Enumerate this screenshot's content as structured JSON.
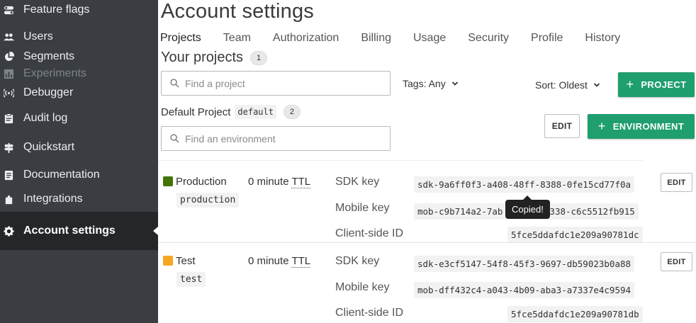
{
  "sidebar": {
    "items": [
      {
        "label": "Feature flags",
        "icon": "toggle-icon"
      },
      {
        "label": "Users",
        "icon": "users-icon"
      },
      {
        "label": "Segments",
        "icon": "pie-chart-icon"
      },
      {
        "label": "Experiments",
        "icon": "bar-chart-icon"
      },
      {
        "label": "Debugger",
        "icon": "broadcast-icon"
      },
      {
        "label": "Audit log",
        "icon": "clipboard-icon"
      },
      {
        "label": "Quickstart",
        "icon": "signpost-icon"
      },
      {
        "label": "Documentation",
        "icon": "book-icon"
      },
      {
        "label": "Integrations",
        "icon": "puzzle-icon"
      },
      {
        "label": "Account settings",
        "icon": "gear-icon"
      }
    ]
  },
  "page": {
    "title": "Account settings",
    "tabs": [
      "Projects",
      "Team",
      "Authorization",
      "Billing",
      "Usage",
      "Security",
      "Profile",
      "History"
    ],
    "subtitle": "Your projects",
    "project_count": "1"
  },
  "controls": {
    "project_search_placeholder": "Find a project",
    "tags_label": "Tags: Any",
    "sort_label": "Sort: Oldest",
    "add_project_label": "PROJECT",
    "env_search_placeholder": "Find an environment",
    "edit_label": "EDIT",
    "add_environment_label": "ENVIRONMENT"
  },
  "project": {
    "name": "Default Project",
    "key": "default",
    "env_count": "2"
  },
  "environments": [
    {
      "name": "Production",
      "key": "production",
      "color": "#417505",
      "ttl_value": "0 minute",
      "ttl_abbr": "TTL",
      "sdk_label": "SDK key",
      "sdk_key": "sdk-9a6ff0f3-a408-48ff-8388-0fe15cd77f0a",
      "mobile_label": "Mobile key",
      "mobile_key_start": "mob-c9b714a2-7ab",
      "mobile_key_end": "338-c6c5512fb915",
      "client_label": "Client-side ID",
      "client_id": "5fce5ddafdc1e209a90781dc",
      "edit_label": "EDIT"
    },
    {
      "name": "Test",
      "key": "test",
      "color": "#f5a623",
      "ttl_value": "0 minute",
      "ttl_abbr": "TTL",
      "sdk_label": "SDK key",
      "sdk_key": "sdk-e3cf5147-54f8-45f3-9697-db59023b0a88",
      "mobile_label": "Mobile key",
      "mobile_key": "mob-dff432c4-a043-4b09-aba3-a7337e4c9594",
      "client_label": "Client-side ID",
      "client_id": "5fce5ddafdc1e209a90781db",
      "edit_label": "EDIT"
    }
  ],
  "tooltip": {
    "text": "Copied!"
  }
}
